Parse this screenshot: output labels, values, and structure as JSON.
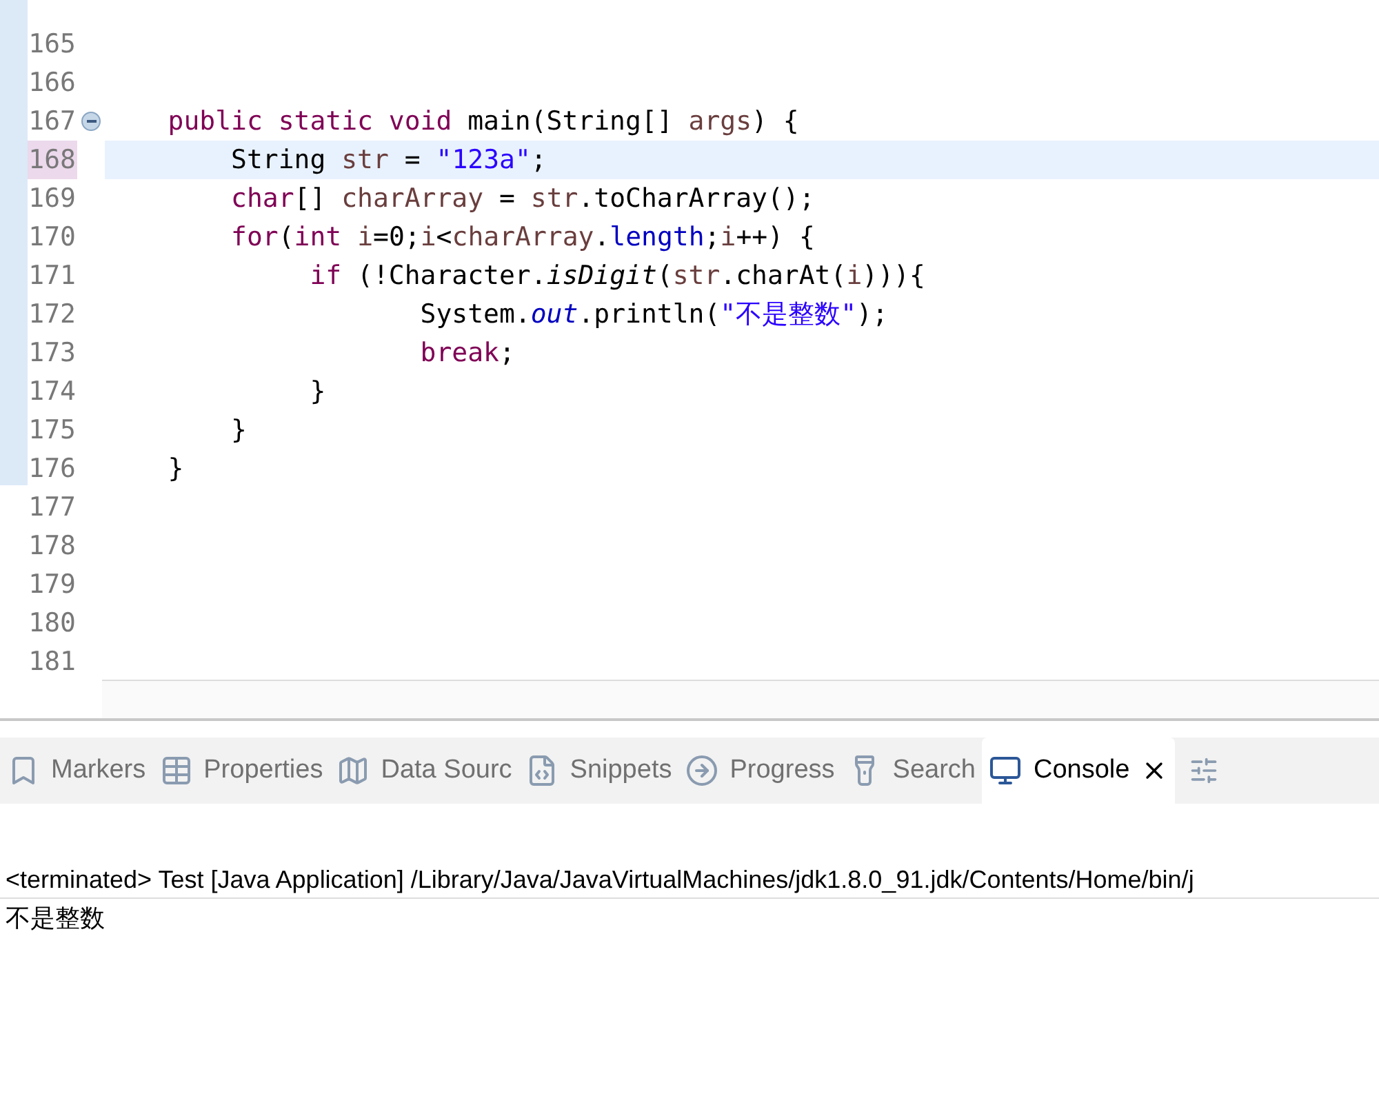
{
  "editor": {
    "lines": [
      {
        "number": "165",
        "current": false,
        "fold": false
      },
      {
        "number": "166",
        "current": false,
        "fold": false
      },
      {
        "number": "167",
        "current": false,
        "fold": true,
        "tokens": [
          {
            "kind": "kw",
            "text": "    public static void"
          },
          {
            "kind": "plain",
            "text": " main(String[] "
          },
          {
            "kind": "var",
            "text": "args"
          },
          {
            "kind": "plain",
            "text": ") {"
          }
        ]
      },
      {
        "number": "168",
        "current": true,
        "fold": false,
        "tokens": [
          {
            "kind": "plain",
            "text": "        String "
          },
          {
            "kind": "var",
            "text": "str"
          },
          {
            "kind": "plain",
            "text": " = "
          },
          {
            "kind": "str",
            "text": "\"123a\""
          },
          {
            "kind": "plain",
            "text": ";"
          }
        ]
      },
      {
        "number": "169",
        "current": false,
        "fold": false,
        "tokens": [
          {
            "kind": "kw",
            "text": "        char"
          },
          {
            "kind": "plain",
            "text": "[] "
          },
          {
            "kind": "var",
            "text": "charArray"
          },
          {
            "kind": "plain",
            "text": " = "
          },
          {
            "kind": "var",
            "text": "str"
          },
          {
            "kind": "plain",
            "text": ".toCharArray();"
          }
        ]
      },
      {
        "number": "170",
        "current": false,
        "fold": false,
        "tokens": [
          {
            "kind": "kw",
            "text": "        for"
          },
          {
            "kind": "plain",
            "text": "("
          },
          {
            "kind": "kw",
            "text": "int "
          },
          {
            "kind": "var",
            "text": "i"
          },
          {
            "kind": "plain",
            "text": "=0;"
          },
          {
            "kind": "var",
            "text": "i"
          },
          {
            "kind": "plain",
            "text": "<"
          },
          {
            "kind": "var",
            "text": "charArray"
          },
          {
            "kind": "plain",
            "text": "."
          },
          {
            "kind": "field",
            "text": "length"
          },
          {
            "kind": "plain",
            "text": ";"
          },
          {
            "kind": "var",
            "text": "i"
          },
          {
            "kind": "plain",
            "text": "++) {"
          }
        ]
      },
      {
        "number": "171",
        "current": false,
        "fold": false,
        "tokens": [
          {
            "kind": "kw",
            "text": "             if"
          },
          {
            "kind": "plain",
            "text": " (!Character."
          },
          {
            "kind": "italic",
            "text": "isDigit"
          },
          {
            "kind": "plain",
            "text": "("
          },
          {
            "kind": "var",
            "text": "str"
          },
          {
            "kind": "plain",
            "text": ".charAt("
          },
          {
            "kind": "var",
            "text": "i"
          },
          {
            "kind": "plain",
            "text": "))){"
          }
        ]
      },
      {
        "number": "172",
        "current": false,
        "fold": false,
        "tokens": [
          {
            "kind": "plain",
            "text": "                    System."
          },
          {
            "kind": "static",
            "text": "out"
          },
          {
            "kind": "plain",
            "text": ".println("
          },
          {
            "kind": "str",
            "text": "\"不是整数\""
          },
          {
            "kind": "plain",
            "text": ");"
          }
        ]
      },
      {
        "number": "173",
        "current": false,
        "fold": false,
        "tokens": [
          {
            "kind": "kw",
            "text": "                    break"
          },
          {
            "kind": "plain",
            "text": ";"
          }
        ]
      },
      {
        "number": "174",
        "current": false,
        "fold": false,
        "tokens": [
          {
            "kind": "plain",
            "text": "             }"
          }
        ]
      },
      {
        "number": "175",
        "current": false,
        "fold": false,
        "tokens": [
          {
            "kind": "plain",
            "text": "        }"
          }
        ]
      },
      {
        "number": "176",
        "current": false,
        "fold": false,
        "tokens": [
          {
            "kind": "plain",
            "text": "    }"
          }
        ]
      },
      {
        "number": "177",
        "current": false,
        "fold": false
      },
      {
        "number": "178",
        "current": false,
        "fold": false
      },
      {
        "number": "179",
        "current": false,
        "fold": false
      },
      {
        "number": "180",
        "current": false,
        "fold": false
      },
      {
        "number": "181",
        "current": false,
        "fold": false
      }
    ]
  },
  "panel_tabs": [
    {
      "label": "Markers",
      "selected": false,
      "closable": false
    },
    {
      "label": "Properties",
      "selected": false,
      "closable": false
    },
    {
      "label": "Data Sourc",
      "selected": false,
      "closable": false
    },
    {
      "label": "Snippets",
      "selected": false,
      "closable": false
    },
    {
      "label": "Progress",
      "selected": false,
      "closable": false
    },
    {
      "label": "Search",
      "selected": false,
      "closable": false
    },
    {
      "label": "Console",
      "selected": true,
      "closable": true
    }
  ],
  "console": {
    "header": "<terminated> Test [Java Application] /Library/Java/JavaVirtualMachines/jdk1.8.0_91.jdk/Contents/Home/bin/j",
    "output": [
      "不是整数"
    ]
  }
}
